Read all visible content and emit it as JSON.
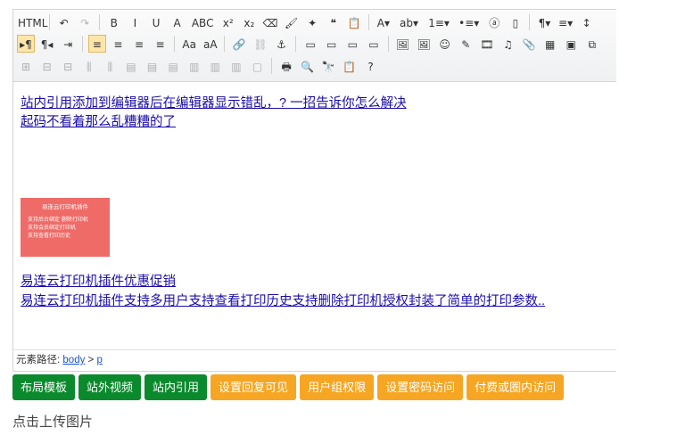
{
  "toolbar": {
    "row1": [
      {
        "name": "source-html-button",
        "glyph": "HTML"
      },
      {
        "sep": true
      },
      {
        "name": "undo-icon",
        "glyph": "↶"
      },
      {
        "name": "redo-icon",
        "glyph": "↷",
        "disabled": true
      },
      {
        "sep": true
      },
      {
        "name": "bold-button",
        "glyph": "B"
      },
      {
        "name": "italic-button",
        "glyph": "I"
      },
      {
        "name": "underline-button",
        "glyph": "U"
      },
      {
        "name": "font-border-button",
        "glyph": "A"
      },
      {
        "name": "strikethrough-button",
        "glyph": "ABC"
      },
      {
        "name": "superscript-button",
        "glyph": "x²"
      },
      {
        "name": "subscript-button",
        "glyph": "x₂"
      },
      {
        "name": "eraser-icon",
        "glyph": "⌫"
      },
      {
        "name": "format-painter-icon",
        "glyph": "🖌"
      },
      {
        "name": "auto-type-icon",
        "glyph": "✦"
      },
      {
        "name": "blockquote-icon",
        "glyph": "❝"
      },
      {
        "name": "paste-plain-icon",
        "glyph": "📋"
      },
      {
        "sep": true
      },
      {
        "name": "font-color-button",
        "glyph": "A▾"
      },
      {
        "name": "highlight-color-button",
        "glyph": "ab▾"
      },
      {
        "name": "ordered-list-button",
        "glyph": "1≡▾"
      },
      {
        "name": "unordered-list-button",
        "glyph": "•≡▾"
      },
      {
        "name": "select-all-icon",
        "glyph": "ⓐ"
      },
      {
        "name": "clear-doc-icon",
        "glyph": "▯"
      },
      {
        "sep": true
      },
      {
        "name": "paragraph-format-button",
        "glyph": "¶▾"
      },
      {
        "name": "font-family-button",
        "glyph": "≡▾"
      },
      {
        "name": "font-size-button",
        "glyph": "↕"
      }
    ],
    "row2": [
      {
        "name": "ltr-direction-icon",
        "glyph": "▸¶",
        "active": true
      },
      {
        "name": "rtl-direction-icon",
        "glyph": "¶◂"
      },
      {
        "name": "indent-icon",
        "glyph": "⇥"
      },
      {
        "sep": true
      },
      {
        "name": "align-left-icon",
        "glyph": "≡",
        "active": true
      },
      {
        "name": "align-center-icon",
        "glyph": "≡"
      },
      {
        "name": "align-right-icon",
        "glyph": "≡"
      },
      {
        "name": "align-justify-icon",
        "glyph": "≡"
      },
      {
        "sep": true
      },
      {
        "name": "uppercase-icon",
        "glyph": "Aa"
      },
      {
        "name": "lowercase-icon",
        "glyph": "aA"
      },
      {
        "sep": true
      },
      {
        "name": "link-icon",
        "glyph": "🔗"
      },
      {
        "name": "unlink-icon",
        "glyph": "⛓",
        "disabled": true
      },
      {
        "name": "anchor-icon",
        "glyph": "⚓"
      },
      {
        "sep": true
      },
      {
        "name": "image-none-icon",
        "glyph": "▭"
      },
      {
        "name": "image-left-icon",
        "glyph": "▭"
      },
      {
        "name": "image-right-icon",
        "glyph": "▭"
      },
      {
        "name": "image-center-icon",
        "glyph": "▭"
      },
      {
        "sep": true
      },
      {
        "name": "simple-upload-icon",
        "glyph": "🖼"
      },
      {
        "name": "insert-image-icon",
        "glyph": "🖼"
      },
      {
        "name": "emotion-icon",
        "glyph": "☺"
      },
      {
        "name": "scrawl-icon",
        "glyph": "✎"
      },
      {
        "name": "insert-video-icon",
        "glyph": "🎞"
      },
      {
        "name": "music-icon",
        "glyph": "♫"
      },
      {
        "name": "attachment-icon",
        "glyph": "📎"
      },
      {
        "name": "map-icon",
        "glyph": "▦"
      },
      {
        "name": "gmap-icon",
        "glyph": "▣"
      },
      {
        "name": "iframe-icon",
        "glyph": "⧉"
      }
    ],
    "row3": [
      {
        "name": "table-icon",
        "glyph": "⊞",
        "disabled": true
      },
      {
        "name": "insert-row-icon",
        "glyph": "⊟",
        "disabled": true
      },
      {
        "name": "delete-row-icon",
        "glyph": "⊟",
        "disabled": true
      },
      {
        "name": "insert-col-icon",
        "glyph": "⫼",
        "disabled": true
      },
      {
        "name": "delete-col-icon",
        "glyph": "⫼",
        "disabled": true
      },
      {
        "name": "merge-cells-icon",
        "glyph": "▤",
        "disabled": true
      },
      {
        "name": "merge-right-icon",
        "glyph": "▤",
        "disabled": true
      },
      {
        "name": "merge-down-icon",
        "glyph": "▤",
        "disabled": true
      },
      {
        "name": "split-cells-icon",
        "glyph": "▥",
        "disabled": true
      },
      {
        "name": "split-rows-icon",
        "glyph": "▥",
        "disabled": true
      },
      {
        "name": "split-cols-icon",
        "glyph": "▥",
        "disabled": true
      },
      {
        "name": "table-props-icon",
        "glyph": "▢",
        "disabled": true
      },
      {
        "sep": true
      },
      {
        "name": "print-icon",
        "glyph": "🖶"
      },
      {
        "name": "preview-icon",
        "glyph": "🔍"
      },
      {
        "name": "search-replace-icon",
        "glyph": "🔭"
      },
      {
        "name": "drafts-icon",
        "glyph": "📋"
      },
      {
        "name": "help-icon",
        "glyph": "?"
      }
    ]
  },
  "content": {
    "line1": "站内引用添加到编辑器后在编辑器显示错乱，? 一招告诉你怎么解决",
    "line2": "起码不看着那么乱糟糟的了",
    "promo_title": "易连云打印机插件",
    "promo_lines": [
      "支持后台绑定 删除打印机",
      "支持会员绑定打印机",
      "支持查看打印历史"
    ],
    "line3": "易连云打印机插件优惠促销",
    "line4": "易连云打印机插件支持多用户支持查看打印历史支持删除打印机授权封装了简单的打印参数.."
  },
  "elementpath": {
    "label": "元素路径:",
    "body": "body",
    "gt": ">",
    "p": "p"
  },
  "actions": [
    {
      "label": "布局模板",
      "color": "#0b8a2d"
    },
    {
      "label": "站外视频",
      "color": "#0b8a2d"
    },
    {
      "label": "站内引用",
      "color": "#0b8a2d"
    },
    {
      "label": "设置回复可见",
      "color": "#f6a623"
    },
    {
      "label": "用户组权限",
      "color": "#f6a623"
    },
    {
      "label": "设置密码访问",
      "color": "#f6a623"
    },
    {
      "label": "付费或圈内访问",
      "color": "#f6a623"
    }
  ],
  "upload_label": "点击上传图片"
}
